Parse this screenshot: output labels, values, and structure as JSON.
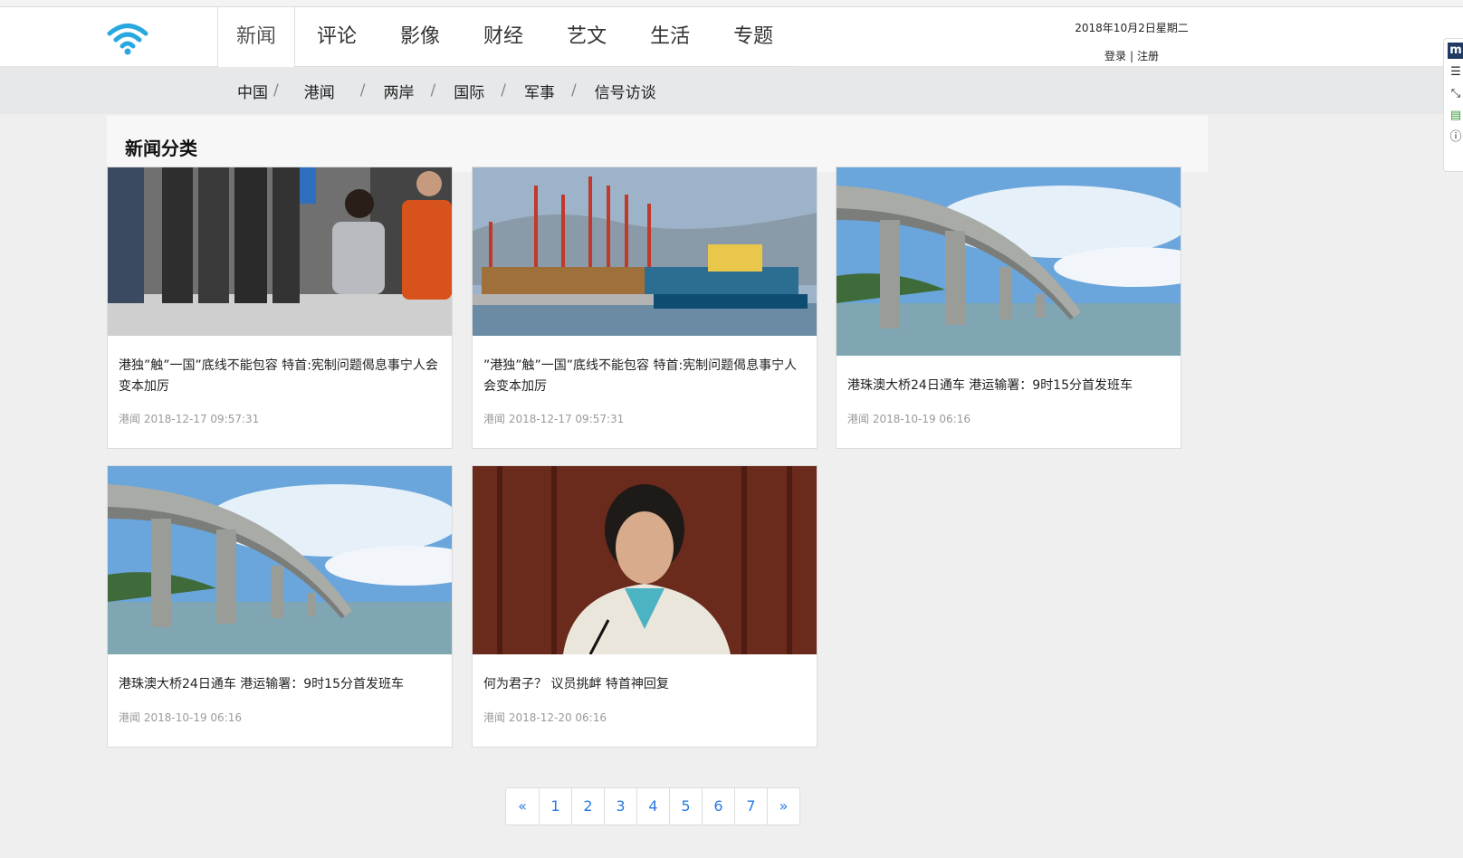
{
  "header": {
    "date": "2018年10月2日星期二",
    "login": "登录",
    "separator": "|",
    "register": "注册",
    "logo_icon": "wifi-icon"
  },
  "nav": {
    "items": [
      "新闻",
      "评论",
      "影像",
      "财经",
      "艺文",
      "生活",
      "专题"
    ],
    "active": "新闻"
  },
  "subnav": {
    "items": [
      "中国",
      "港闻",
      "两岸",
      "国际",
      "军事",
      "信号访谈"
    ],
    "separator": "/"
  },
  "section": {
    "title": "新闻分类"
  },
  "articles": [
    {
      "title": "港独”触”一国”底线不能包容 特首:宪制问题偈息事宁人会变本加厉",
      "category": "港闻",
      "time": "2018-12-17 09:57:31",
      "image": "press-conference-photo"
    },
    {
      "title": "”港独”触”一国”底线不能包容 特首:宪制问题偈息事宁人会变本加厉",
      "category": "港闻",
      "time": "2018-12-17 09:57:31",
      "image": "container-port-photo"
    },
    {
      "title": "港珠澳大桥24日通车 港运输署：9时15分首发班车",
      "category": "港闻",
      "time": "2018-10-19 06:16",
      "image": "bridge-photo"
    },
    {
      "title": "港珠澳大桥24日通车 港运输署：9时15分首发班车",
      "category": "港闻",
      "time": "2018-10-19 06:16",
      "image": "bridge-photo"
    },
    {
      "title": "何为君子？ 议员挑衅 特首神回复",
      "category": "港闻",
      "time": "2018-12-20 06:16",
      "image": "speaker-podium-photo"
    }
  ],
  "pagination": {
    "prev": "«",
    "pages": [
      "1",
      "2",
      "3",
      "4",
      "5",
      "6",
      "7"
    ],
    "next": "»"
  },
  "colors": {
    "accent": "#2a7ae2",
    "logo": "#29a8e0",
    "subnav_bg": "#e6e8ea",
    "page_bg": "#efefef"
  }
}
